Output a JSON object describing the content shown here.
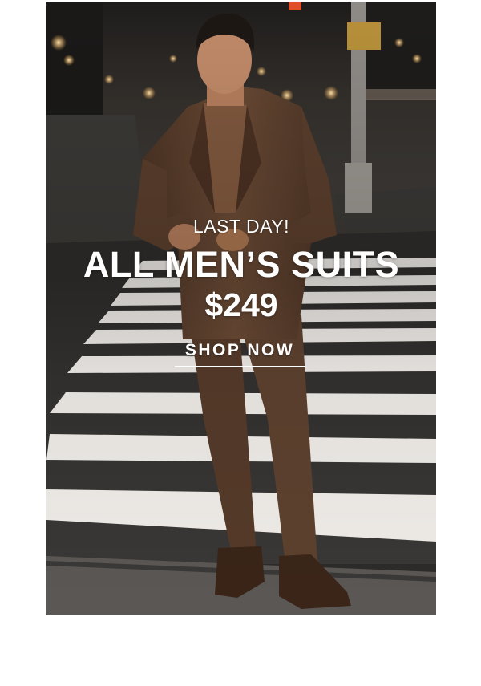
{
  "promo": {
    "eyebrow": "LAST DAY!",
    "headline": "ALL MEN’S SUITS",
    "price": "$249",
    "cta_label": "SHOP NOW"
  },
  "colors": {
    "text": "#ffffff",
    "suit": "#5a3f2e",
    "background": "#ffffff",
    "street": "#2a2725"
  }
}
